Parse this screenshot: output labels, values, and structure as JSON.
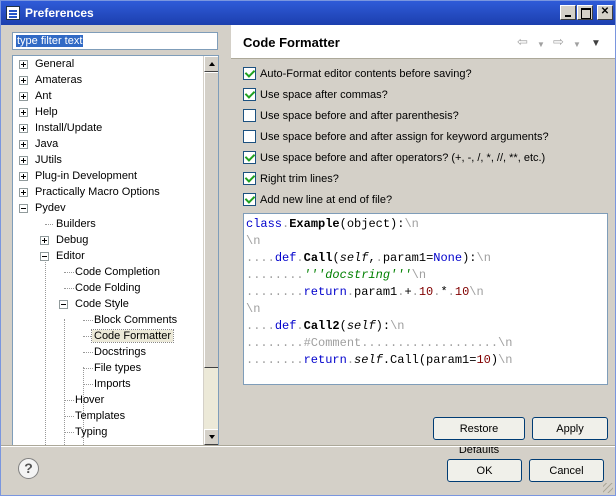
{
  "window": {
    "title": "Preferences"
  },
  "filter": {
    "placeholder": "type filter text",
    "value": "type filter text"
  },
  "tree": {
    "items": [
      {
        "label": "General",
        "level": 0,
        "expander": "plus"
      },
      {
        "label": "Amateras",
        "level": 0,
        "expander": "plus"
      },
      {
        "label": "Ant",
        "level": 0,
        "expander": "plus"
      },
      {
        "label": "Help",
        "level": 0,
        "expander": "plus"
      },
      {
        "label": "Install/Update",
        "level": 0,
        "expander": "plus"
      },
      {
        "label": "Java",
        "level": 0,
        "expander": "plus"
      },
      {
        "label": "JUtils",
        "level": 0,
        "expander": "plus"
      },
      {
        "label": "Plug-in Development",
        "level": 0,
        "expander": "plus"
      },
      {
        "label": "Practically Macro Options",
        "level": 0,
        "expander": "plus"
      },
      {
        "label": "Pydev",
        "level": 0,
        "expander": "minus"
      },
      {
        "label": "Builders",
        "level": 1,
        "expander": "none"
      },
      {
        "label": "Debug",
        "level": 1,
        "expander": "plus"
      },
      {
        "label": "Editor",
        "level": 1,
        "expander": "minus"
      },
      {
        "label": "Code Completion",
        "level": 2,
        "expander": "none"
      },
      {
        "label": "Code Folding",
        "level": 2,
        "expander": "none"
      },
      {
        "label": "Code Style",
        "level": 2,
        "expander": "minus"
      },
      {
        "label": "Block Comments",
        "level": 3,
        "expander": "none"
      },
      {
        "label": "Code Formatter",
        "level": 3,
        "expander": "none",
        "selected": true
      },
      {
        "label": "Docstrings",
        "level": 3,
        "expander": "none"
      },
      {
        "label": "File types",
        "level": 3,
        "expander": "none"
      },
      {
        "label": "Imports",
        "level": 3,
        "expander": "none"
      },
      {
        "label": "Hover",
        "level": 2,
        "expander": "none"
      },
      {
        "label": "Templates",
        "level": 2,
        "expander": "none"
      },
      {
        "label": "Typing",
        "level": 2,
        "expander": "none"
      }
    ]
  },
  "page": {
    "title": "Code Formatter",
    "options": [
      {
        "label": "Auto-Format editor contents before saving?",
        "checked": true
      },
      {
        "label": "Use space after commas?",
        "checked": true
      },
      {
        "label": "Use space before and after parenthesis?",
        "checked": false
      },
      {
        "label": "Use space before and after assign for keyword arguments?",
        "checked": false
      },
      {
        "label": "Use space before and after operators? (+, -, /, *, //, **, etc.)",
        "checked": true
      },
      {
        "label": "Right trim lines?",
        "checked": true
      },
      {
        "label": "Add new line at end of file?",
        "checked": true
      }
    ],
    "preview": {
      "line1": {
        "kw": "class",
        "d1": ".",
        "name": "Example",
        "rest": "(object):",
        "nl": "\\n"
      },
      "line2": {
        "nl": "\\n"
      },
      "line3": {
        "ind": "....",
        "kw": "def",
        "d1": ".",
        "name": "Call",
        "p1": "(",
        "self": "self",
        "p2": ",",
        "d2": ".",
        "p3": "param1=",
        "none": "None",
        "p4": "):",
        "nl": "\\n"
      },
      "line4": {
        "ind": "........",
        "str": "'''docstring'''",
        "nl": "\\n"
      },
      "line5": {
        "ind": "........",
        "kw": "return",
        "d1": ".",
        "p1": "param1",
        "d2": ".",
        "op1": "+",
        "d3": ".",
        "n1": "10",
        "d4": ".",
        "op2": "*",
        "d5": ".",
        "n2": "10",
        "nl": "\\n"
      },
      "line6": {
        "nl": "\\n"
      },
      "line7": {
        "ind": "....",
        "kw": "def",
        "d1": ".",
        "name": "Call2",
        "p1": "(",
        "self": "self",
        "p2": "):",
        "nl": "\\n"
      },
      "line8": {
        "ind": "........",
        "cmt": "#Comment...................",
        "nl": "\\n"
      },
      "line9": {
        "ind": "........",
        "kw": "return",
        "d1": ".",
        "self": "self",
        "p1": ".Call(param1=",
        "n1": "10",
        "p2": ")",
        "nl": "\\n"
      }
    },
    "restore_defaults_label": "Restore Defaults",
    "apply_label": "Apply"
  },
  "footer": {
    "help_glyph": "?",
    "ok_label": "OK",
    "cancel_label": "Cancel"
  }
}
